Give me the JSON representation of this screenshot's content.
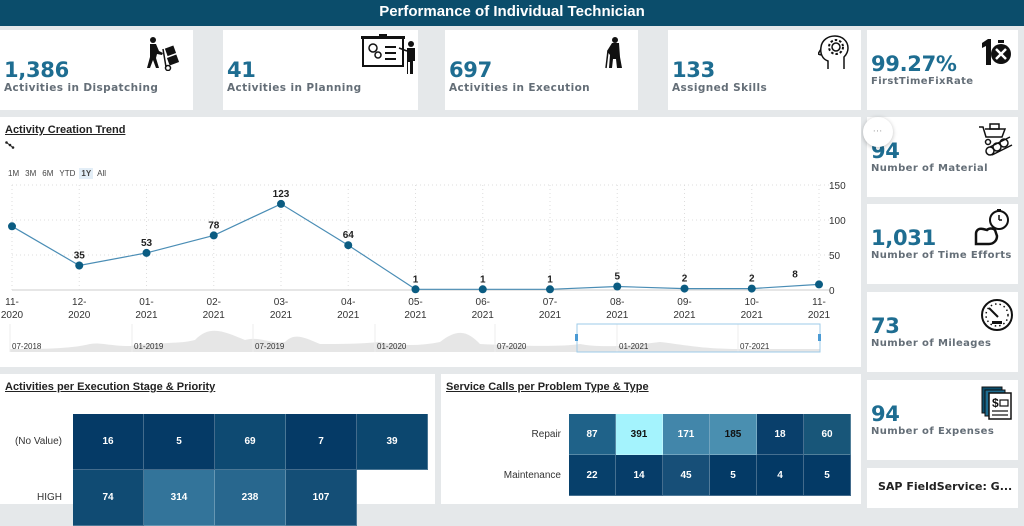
{
  "header": {
    "title": "Performance of Individual Technician"
  },
  "kpis": [
    {
      "value": "1,386",
      "label": "Activities in Dispatching",
      "icon": "hand-truck-icon"
    },
    {
      "value": "41",
      "label": "Activities in Planning",
      "icon": "presentation-board-icon"
    },
    {
      "value": "697",
      "label": "Activities in Execution",
      "icon": "worker-drilling-icon"
    },
    {
      "value": "133",
      "label": "Assigned Skills",
      "icon": "head-gear-icon"
    },
    {
      "value": "99.27%",
      "label": "FirstTimeFixRate",
      "icon": "first-time-fix-icon"
    },
    {
      "value": "94",
      "label": "Number of Material",
      "icon": "wheelbarrow-logs-icon"
    },
    {
      "value": "1,031",
      "label": "Number of Time Efforts",
      "icon": "stopwatch-arm-icon"
    },
    {
      "value": "73",
      "label": "Number of Mileages",
      "icon": "speedometer-icon"
    },
    {
      "value": "94",
      "label": "Number of Expenses",
      "icon": "expense-receipts-icon"
    }
  ],
  "side_card": {
    "title": "SAP FieldService: G..."
  },
  "more_button": {
    "label": "∙∙∙"
  },
  "trend": {
    "title": "Activity Creation Trend",
    "range_buttons": [
      "1M",
      "3M",
      "6M",
      "YTD",
      "1Y",
      "All"
    ],
    "active_range": "1Y"
  },
  "chart_data": [
    {
      "type": "line",
      "title": "Activity Creation Trend",
      "x": [
        "11-2020",
        "12-2020",
        "01-2021",
        "02-2021",
        "03-2021",
        "04-2021",
        "05-2021",
        "06-2021",
        "07-2021",
        "08-2021",
        "09-2021",
        "10-2021",
        "11-2021"
      ],
      "x_tick_labels": [
        [
          "11-",
          "2020"
        ],
        [
          "12-",
          "2020"
        ],
        [
          "01-",
          "2021"
        ],
        [
          "02-",
          "2021"
        ],
        [
          "03-",
          "2021"
        ],
        [
          "04-",
          "2021"
        ],
        [
          "05-",
          "2021"
        ],
        [
          "06-",
          "2021"
        ],
        [
          "07-",
          "2021"
        ],
        [
          "08-",
          "2021"
        ],
        [
          "09-",
          "2021"
        ],
        [
          "10-",
          "2021"
        ],
        [
          "11-",
          "2021"
        ]
      ],
      "values": [
        91,
        35,
        53,
        78,
        123,
        64,
        1,
        1,
        1,
        5,
        2,
        2,
        8
      ],
      "data_labels": [
        "",
        "35",
        "53",
        "78",
        "123",
        "64",
        "1",
        "1",
        "1",
        "5",
        "2",
        "2",
        "8"
      ],
      "y_ticks": [
        0,
        50,
        100,
        150
      ],
      "ylim": [
        0,
        150
      ],
      "y_axis_side": "right",
      "grid": true,
      "color": "#0b5c82",
      "navigator": {
        "labels": [
          "07-2018",
          "01-2019",
          "07-2019",
          "01-2020",
          "07-2020",
          "01-2021",
          "07-2021"
        ],
        "selected_range": [
          "11-2020",
          "11-2021"
        ]
      }
    },
    {
      "type": "heatmap",
      "title": "Activities per Execution Stage & Priority",
      "rows": [
        "(No Value)",
        "HIGH"
      ],
      "values": [
        [
          16,
          5,
          69,
          7,
          39
        ],
        [
          74,
          314,
          238,
          107,
          null
        ]
      ],
      "colors": [
        [
          "#053a66",
          "#053a66",
          "#0e4a72",
          "#053a66",
          "#0c476f"
        ],
        [
          "#104b73",
          "#33749a",
          "#28678e",
          "#144e76",
          null
        ]
      ]
    },
    {
      "type": "heatmap",
      "title": "Service Calls per Problem Type & Type",
      "rows": [
        "Repair",
        "Maintenance"
      ],
      "values": [
        [
          87,
          391,
          171,
          185,
          18,
          60
        ],
        [
          22,
          14,
          45,
          5,
          4,
          5
        ]
      ],
      "colors": [
        [
          "#1f6289",
          "#a4f3fd",
          "#4286aa",
          "#4a8fb0",
          "#093f6b",
          "#185679"
        ],
        [
          "#07406b",
          "#063d69",
          "#174f78",
          "#043a66",
          "#033965",
          "#043a66"
        ]
      ],
      "dark_text_cells": [
        [
          0,
          1
        ],
        [
          0,
          3
        ]
      ]
    }
  ]
}
